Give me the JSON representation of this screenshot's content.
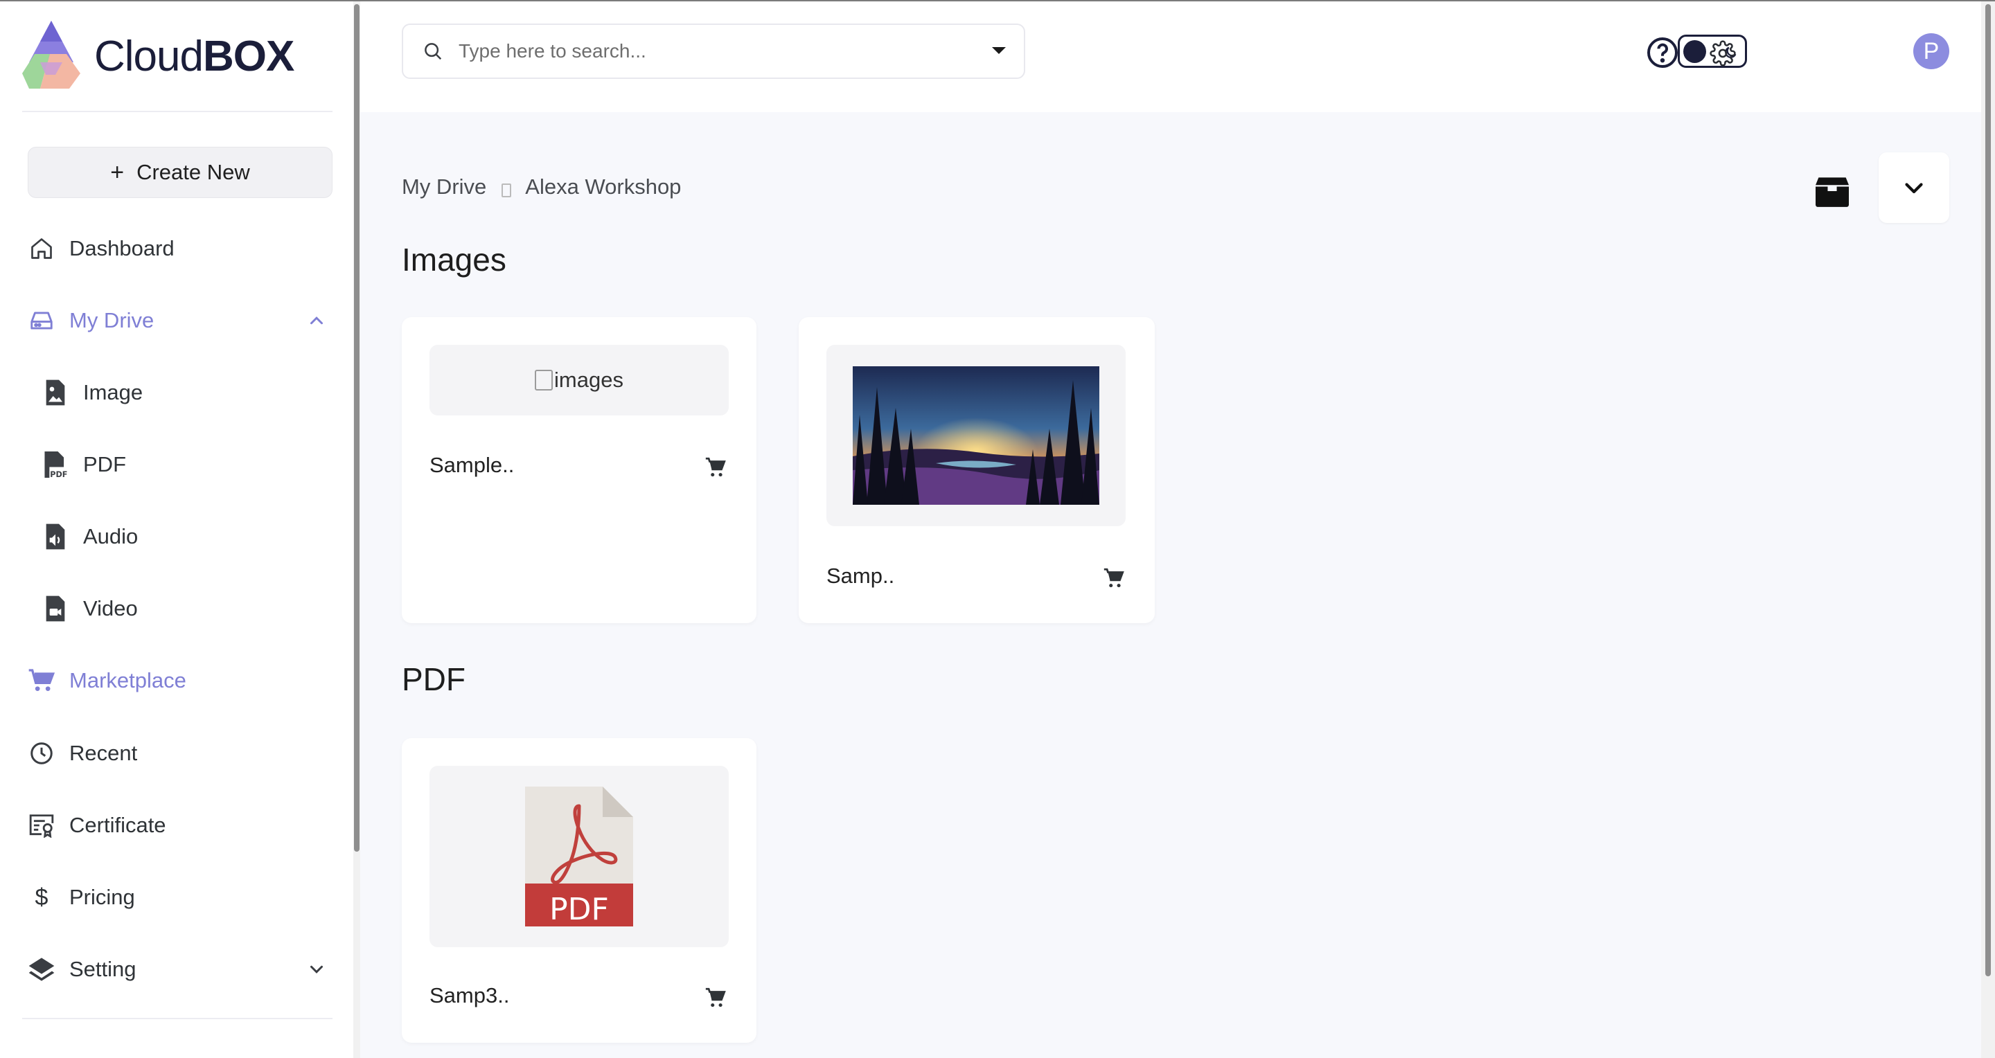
{
  "app": {
    "logo_text_light": "Cloud",
    "logo_text_bold": "BOX",
    "accent_color": "#7f7fd5"
  },
  "sidebar": {
    "create_label": "Create New",
    "items": [
      {
        "label": "Dashboard",
        "icon": "home-icon"
      },
      {
        "label": "My Drive",
        "icon": "drive-icon",
        "active": true,
        "expanded": true
      },
      {
        "label": "Image",
        "icon": "image-file-icon"
      },
      {
        "label": "PDF",
        "icon": "pdf-file-icon"
      },
      {
        "label": "Audio",
        "icon": "audio-file-icon"
      },
      {
        "label": "Video",
        "icon": "video-file-icon"
      },
      {
        "label": "Marketplace",
        "icon": "cart-icon",
        "active": true
      },
      {
        "label": "Recent",
        "icon": "clock-icon"
      },
      {
        "label": "Certificate",
        "icon": "certificate-icon"
      },
      {
        "label": "Pricing",
        "icon": "dollar-icon"
      },
      {
        "label": "Setting",
        "icon": "layers-icon"
      }
    ]
  },
  "header": {
    "search_placeholder": "Type here to search...",
    "avatar_initial": "P"
  },
  "breadcrumb": {
    "root": "My Drive",
    "current": "Alexa Workshop"
  },
  "sections": {
    "images_title": "Images",
    "pdf_title": "PDF"
  },
  "cards": {
    "image1": {
      "alt": "images",
      "name": "Sample.."
    },
    "image2": {
      "name": "Samp.."
    },
    "pdf1": {
      "badge": "PDF",
      "name": "Samp3.."
    }
  }
}
